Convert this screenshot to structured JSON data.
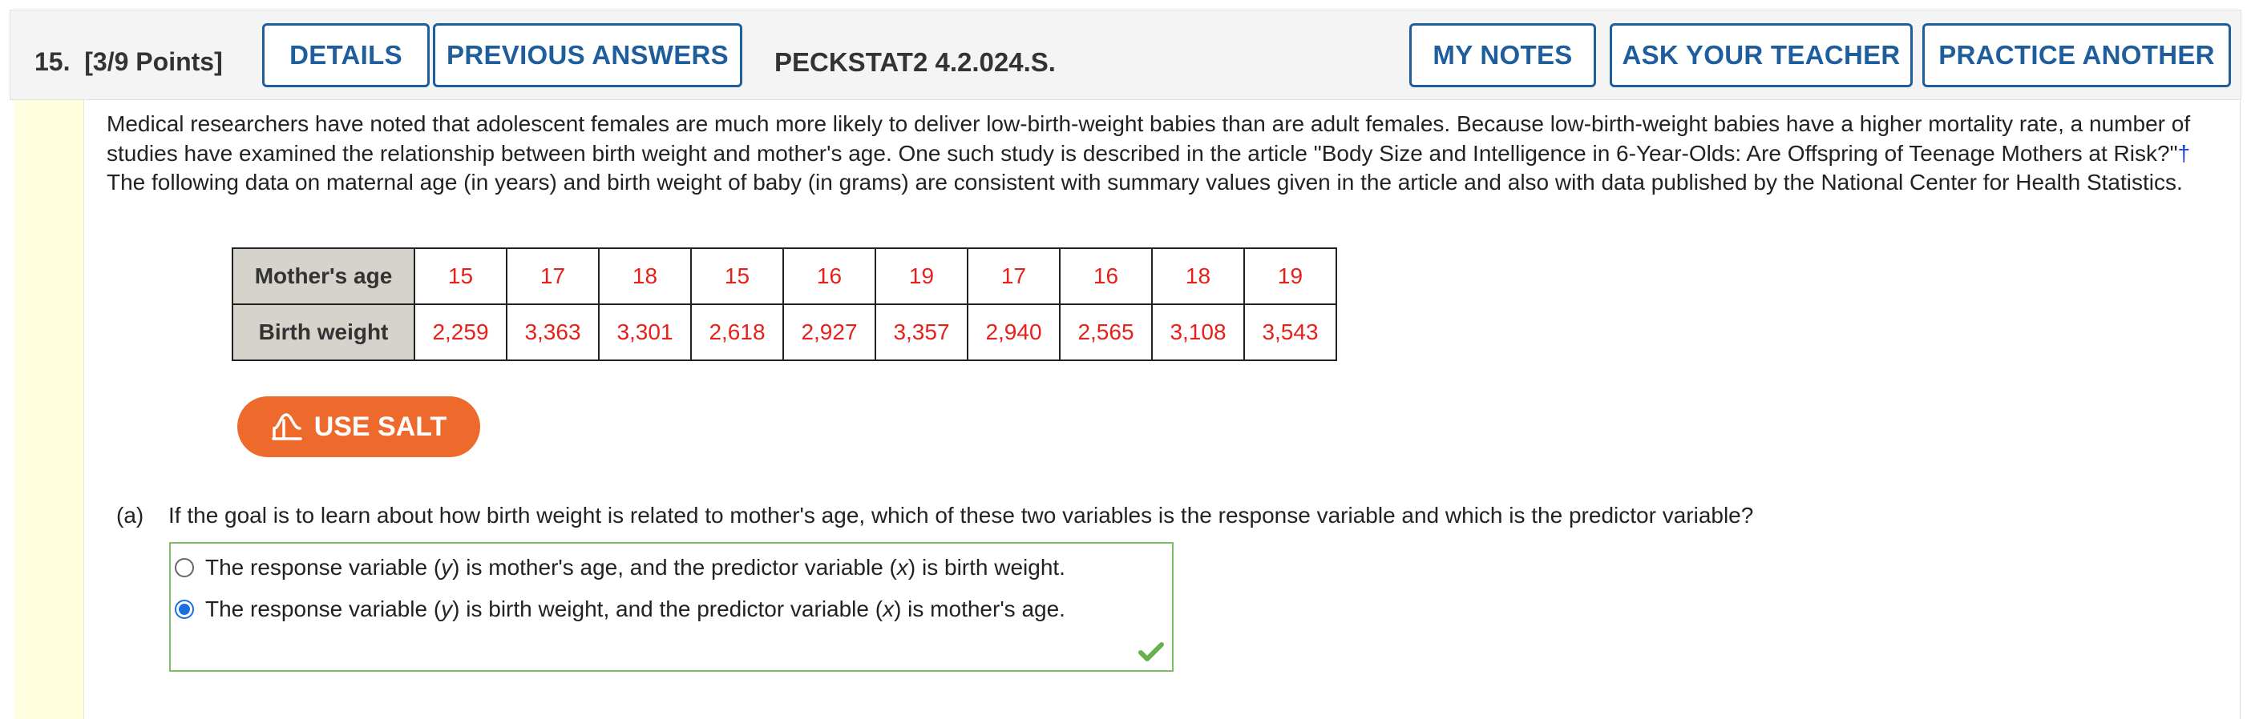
{
  "header": {
    "question_number": "15.",
    "points": "[3/9 Points]",
    "details_label": "DETAILS",
    "previous_answers_label": "PREVIOUS ANSWERS",
    "problem_code": "PECKSTAT2 4.2.024.S.",
    "my_notes_label": "MY NOTES",
    "ask_teacher_label": "ASK YOUR TEACHER",
    "practice_another_label": "PRACTICE ANOTHER"
  },
  "intro": {
    "part1": "Medical researchers have noted that adolescent females are much more likely to deliver low-birth-weight babies than are adult females. Because low-birth-weight babies have a higher mortality rate, a number of studies have examined the relationship between birth weight and mother's age. One such study is described in the article \"Body Size and Intelligence in 6-Year-Olds: Are Offspring of Teenage Mothers at Risk?\"",
    "dagger": "†",
    "part2": " The following data on maternal age (in years) and birth weight of baby (in grams) are consistent with summary values given in the article and also with data published by the National Center for Health Statistics."
  },
  "table": {
    "row1_header": "Mother's age",
    "row1": [
      "15",
      "17",
      "18",
      "15",
      "16",
      "19",
      "17",
      "16",
      "18",
      "19"
    ],
    "row2_header": "Birth weight",
    "row2": [
      "2,259",
      "3,363",
      "3,301",
      "2,618",
      "2,927",
      "3,357",
      "2,940",
      "2,565",
      "3,108",
      "3,543"
    ]
  },
  "salt_button_label": "USE SALT",
  "part_a": {
    "label": "(a)",
    "question": "If the goal is to learn about how birth weight is related to mother's age, which of these two variables is the response variable and which is the predictor variable?",
    "options": [
      {
        "pre": "The response variable (",
        "var1": "y",
        "mid": ") is mother's age, and the predictor variable (",
        "var2": "x",
        "post": ") is birth weight.",
        "selected": false
      },
      {
        "pre": "The response variable (",
        "var1": "y",
        "mid": ") is birth weight, and the predictor variable (",
        "var2": "x",
        "post": ") is mother's age.",
        "selected": true
      }
    ]
  },
  "colors": {
    "accent": "#1f5e9d",
    "table_values": "#e8201a",
    "salt": "#ee6a2c",
    "correct_border": "#7cc063",
    "radio_selected": "#1b6ee0",
    "sidebar": "#ffffe0"
  },
  "icons": {
    "salt": "salt-distribution-icon",
    "correct": "checkmark-icon"
  }
}
